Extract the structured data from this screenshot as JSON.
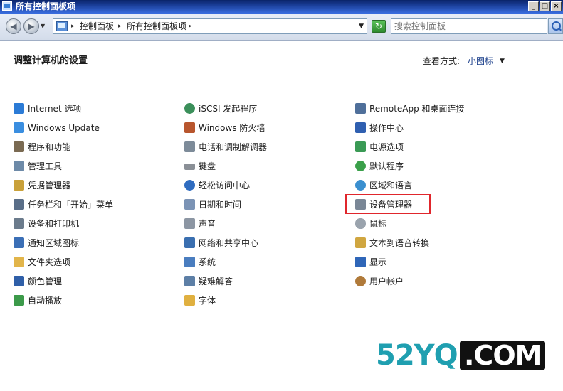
{
  "window": {
    "title": "所有控制面板项"
  },
  "address_bar": {
    "crumbs": [
      "控制面板",
      "所有控制面板项"
    ]
  },
  "search": {
    "placeholder": "搜索控制面板"
  },
  "header": {
    "title": "调整计算机的设置",
    "view_label": "查看方式:",
    "view_value": "小图标"
  },
  "columns": [
    {
      "items": [
        {
          "label": "Internet 选项",
          "icon": "internet-options-icon",
          "color": "#2b7bd6"
        },
        {
          "label": "Windows Update",
          "icon": "windows-update-icon",
          "color": "#3a8ee0"
        },
        {
          "label": "程序和功能",
          "icon": "programs-icon",
          "color": "#7a6a52"
        },
        {
          "label": "管理工具",
          "icon": "admin-tools-icon",
          "color": "#6d8aa8"
        },
        {
          "label": "凭据管理器",
          "icon": "credential-manager-icon",
          "color": "#c9a13a"
        },
        {
          "label": "任务栏和「开始」菜单",
          "icon": "taskbar-icon",
          "color": "#5a6e88"
        },
        {
          "label": "设备和打印机",
          "icon": "printer-icon",
          "color": "#6b7b8c"
        },
        {
          "label": "通知区域图标",
          "icon": "notification-area-icon",
          "color": "#3b6fb6"
        },
        {
          "label": "文件夹选项",
          "icon": "folder-options-icon",
          "color": "#e2b54a"
        },
        {
          "label": "颜色管理",
          "icon": "color-management-icon",
          "color": "#2f5fa8"
        },
        {
          "label": "自动播放",
          "icon": "autoplay-icon",
          "color": "#3c9a4a"
        }
      ]
    },
    {
      "items": [
        {
          "label": "iSCSI 发起程序",
          "icon": "iscsi-icon",
          "color": "#3b8f5a"
        },
        {
          "label": "Windows 防火墙",
          "icon": "firewall-icon",
          "color": "#b8562e"
        },
        {
          "label": "电话和调制解调器",
          "icon": "phone-modem-icon",
          "color": "#7d8b99"
        },
        {
          "label": "键盘",
          "icon": "keyboard-icon",
          "color": "#8a8f96"
        },
        {
          "label": "轻松访问中心",
          "icon": "ease-of-access-icon",
          "color": "#2f6cc0"
        },
        {
          "label": "日期和时间",
          "icon": "date-time-icon",
          "color": "#7b93b5"
        },
        {
          "label": "声音",
          "icon": "sound-icon",
          "color": "#8c96a3"
        },
        {
          "label": "网络和共享中心",
          "icon": "network-sharing-icon",
          "color": "#3a6fb0"
        },
        {
          "label": "系统",
          "icon": "system-icon",
          "color": "#4a7dbf"
        },
        {
          "label": "疑难解答",
          "icon": "troubleshooting-icon",
          "color": "#5d7fa6"
        },
        {
          "label": "字体",
          "icon": "fonts-icon",
          "color": "#e0b040"
        }
      ]
    },
    {
      "items": [
        {
          "label": "RemoteApp 和桌面连接",
          "icon": "remoteapp-icon",
          "color": "#4f6f9a"
        },
        {
          "label": "操作中心",
          "icon": "action-center-icon",
          "color": "#2f5fb0"
        },
        {
          "label": "电源选项",
          "icon": "power-options-icon",
          "color": "#3a9a55"
        },
        {
          "label": "默认程序",
          "icon": "default-programs-icon",
          "color": "#3aa04a"
        },
        {
          "label": "区域和语言",
          "icon": "region-language-icon",
          "color": "#3a8fcf"
        },
        {
          "label": "设备管理器",
          "icon": "device-manager-icon",
          "color": "#7a8796"
        },
        {
          "label": "鼠标",
          "icon": "mouse-icon",
          "color": "#9aa3ad"
        },
        {
          "label": "文本到语音转换",
          "icon": "text-to-speech-icon",
          "color": "#d0a640"
        },
        {
          "label": "显示",
          "icon": "display-icon",
          "color": "#2f66b8"
        },
        {
          "label": "用户帐户",
          "icon": "user-accounts-icon",
          "color": "#b07a3a"
        }
      ]
    }
  ],
  "watermark": {
    "part1": "52YQ",
    "part2": ".COM"
  },
  "colors": {
    "highlight": "#e0262c",
    "title_bar": "#1b3f9a"
  }
}
